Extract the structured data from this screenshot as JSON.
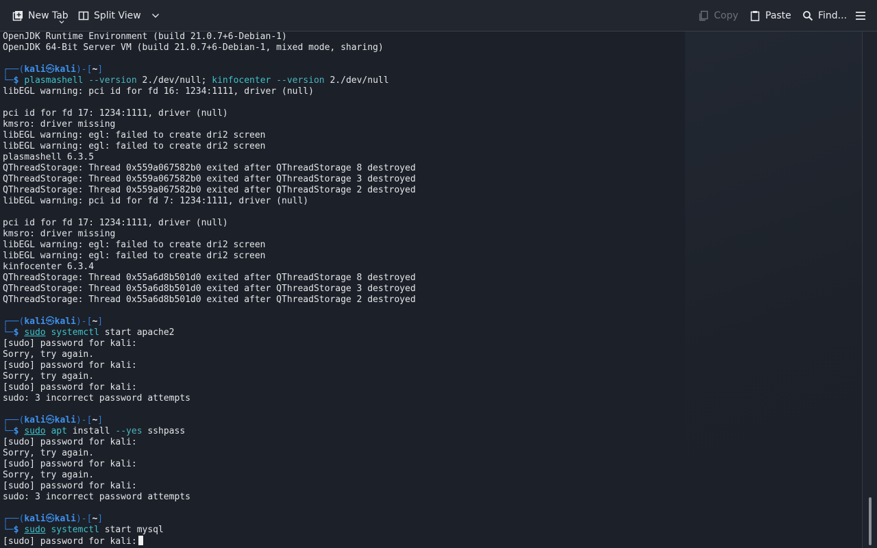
{
  "toolbar": {
    "new_tab_label": "New Tab",
    "split_view_label": "Split View",
    "copy_label": "Copy",
    "paste_label": "Paste",
    "find_label": "Find...",
    "icons": {
      "new_tab": "new-tab-icon",
      "split_view": "split-view-icon",
      "copy": "copy-icon",
      "paste": "paste-icon",
      "find": "search-icon",
      "menu": "hamburger-menu-icon"
    }
  },
  "prompt": {
    "box_top": "┌──(",
    "user": "kali",
    "at": "㉿",
    "host": "kali",
    "dir_open": ")-[",
    "dir": "~",
    "dir_close": "]",
    "box_bottom": "└─",
    "dollar": "$"
  },
  "terminal": {
    "l0": "OpenJDK Runtime Environment (build 21.0.7+6-Debian-1)",
    "l1": "OpenJDK 64-Bit Server VM (build 21.0.7+6-Debian-1, mixed mode, sharing)",
    "c1": {
      "cmd1": "plasmashell",
      "flag1": "--version",
      "redir1": "2./dev/null;",
      "cmd2": "kinfocenter",
      "flag2": "--version",
      "redir2": "2./dev/null"
    },
    "o1": [
      "libEGL warning: pci id for fd 16: 1234:1111, driver (null)",
      "",
      "pci id for fd 17: 1234:1111, driver (null)",
      "kmsro: driver missing",
      "libEGL warning: egl: failed to create dri2 screen",
      "libEGL warning: egl: failed to create dri2 screen",
      "plasmashell 6.3.5",
      "QThreadStorage: Thread 0x559a067582b0 exited after QThreadStorage 8 destroyed",
      "QThreadStorage: Thread 0x559a067582b0 exited after QThreadStorage 3 destroyed",
      "QThreadStorage: Thread 0x559a067582b0 exited after QThreadStorage 2 destroyed",
      "libEGL warning: pci id for fd 7: 1234:1111, driver (null)",
      "",
      "pci id for fd 17: 1234:1111, driver (null)",
      "kmsro: driver missing",
      "libEGL warning: egl: failed to create dri2 screen",
      "libEGL warning: egl: failed to create dri2 screen",
      "kinfocenter 6.3.4",
      "QThreadStorage: Thread 0x55a6d8b501d0 exited after QThreadStorage 8 destroyed",
      "QThreadStorage: Thread 0x55a6d8b501d0 exited after QThreadStorage 3 destroyed",
      "QThreadStorage: Thread 0x55a6d8b501d0 exited after QThreadStorage 2 destroyed"
    ],
    "c2": {
      "sudo": "sudo",
      "cmd": "systemctl",
      "rest": "start apache2"
    },
    "o2": [
      "[sudo] password for kali:",
      "Sorry, try again.",
      "[sudo] password for kali:",
      "Sorry, try again.",
      "[sudo] password for kali:",
      "sudo: 3 incorrect password attempts"
    ],
    "c3": {
      "sudo": "sudo",
      "cmd": "apt",
      "rest1": "install",
      "flag": "--yes",
      "rest2": "sshpass"
    },
    "o3": [
      "[sudo] password for kali:",
      "Sorry, try again.",
      "[sudo] password for kali:",
      "Sorry, try again.",
      "[sudo] password for kali:",
      "sudo: 3 incorrect password attempts"
    ],
    "c4": {
      "sudo": "sudo",
      "cmd": "systemctl",
      "rest": "start mysql"
    },
    "last_line": "[sudo] password for kali:"
  },
  "colors": {
    "prompt": "#3d92f0",
    "command": "#3fc1c9",
    "text": "#e3e5e8",
    "background": "#1c2028"
  }
}
